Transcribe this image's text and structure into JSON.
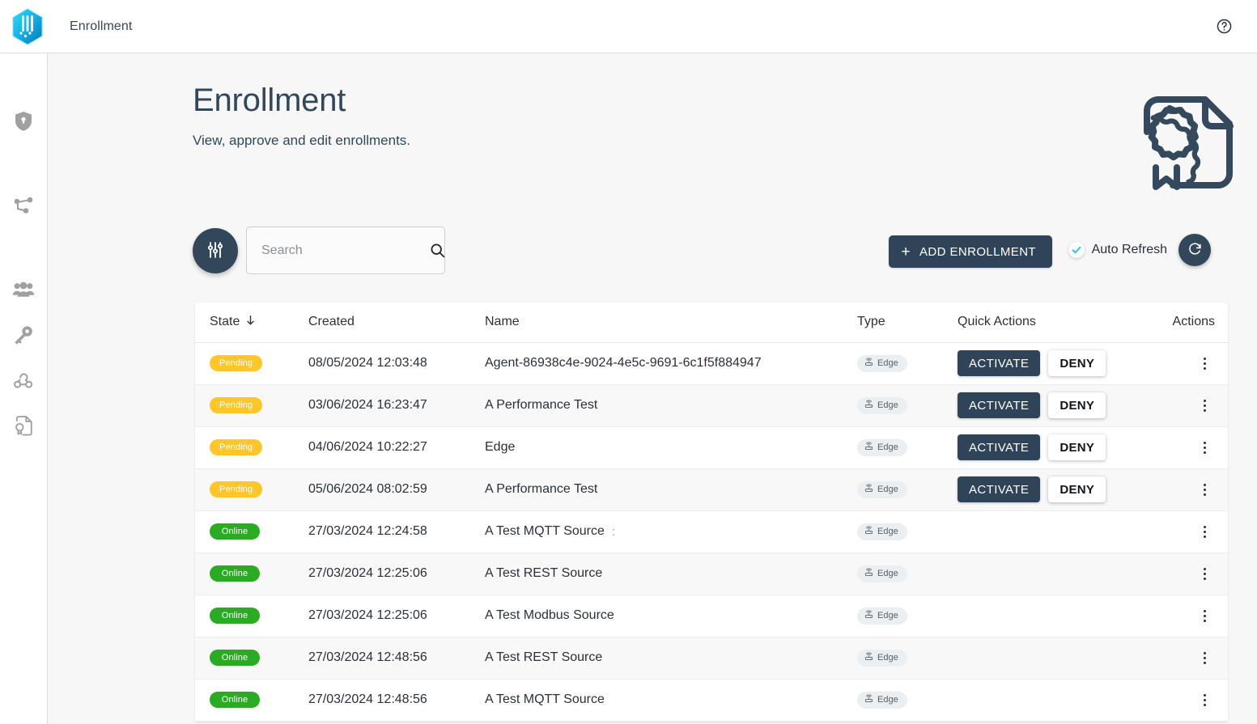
{
  "topbar": {
    "logo_icon": "hexagon-brand-logo",
    "title": "Enrollment",
    "help_icon": "help-circle-icon"
  },
  "sidebar": {
    "items": [
      {
        "icon": "shield-lock-icon",
        "name": "security"
      },
      {
        "icon": "share-network-icon",
        "name": "connections"
      },
      {
        "icon": "people-group-icon",
        "name": "users"
      },
      {
        "icon": "key-icon",
        "name": "credentials"
      },
      {
        "icon": "webhook-icon",
        "name": "webhooks"
      },
      {
        "icon": "certificate-document-icon",
        "name": "enrollment"
      }
    ]
  },
  "page": {
    "title": "Enrollment",
    "subtitle": "View, approve and edit enrollments.",
    "hero_icon": "certificate-document-icon"
  },
  "controls": {
    "filter_icon": "tune-sliders-icon",
    "search": {
      "value": "",
      "placeholder": "Search",
      "icon": "search-icon"
    },
    "add_button": {
      "label": "ADD ENROLLMENT",
      "icon": "plus-icon"
    },
    "auto_refresh": {
      "label": "Auto Refresh",
      "checked": true,
      "icon": "check-icon"
    },
    "refresh_button": {
      "icon": "refresh-icon"
    }
  },
  "table": {
    "columns": [
      {
        "key": "state",
        "label": "State",
        "sort": "desc",
        "sort_icon": "arrow-down-icon"
      },
      {
        "key": "created",
        "label": "Created"
      },
      {
        "key": "name",
        "label": "Name"
      },
      {
        "key": "type",
        "label": "Type"
      },
      {
        "key": "quick",
        "label": "Quick Actions"
      },
      {
        "key": "actions",
        "label": "Actions"
      }
    ],
    "quick_action_labels": {
      "activate": "ACTIVATE",
      "deny": "DENY"
    },
    "rows": [
      {
        "state": "Pending",
        "state_kind": "pending",
        "created": "08/05/2024 12:03:48",
        "name": "Agent-86938c4e-9024-4e5c-9691-6c1f5f884947",
        "name_suffix": "",
        "type": "Edge",
        "type_icon": "router-edge-icon",
        "quick_actions": true
      },
      {
        "state": "Pending",
        "state_kind": "pending",
        "created": "03/06/2024 16:23:47",
        "name": "A Performance Test",
        "name_suffix": "",
        "type": "Edge",
        "type_icon": "router-edge-icon",
        "quick_actions": true
      },
      {
        "state": "Pending",
        "state_kind": "pending",
        "created": "04/06/2024 10:22:27",
        "name": "Edge",
        "name_suffix": "",
        "type": "Edge",
        "type_icon": "router-edge-icon",
        "quick_actions": true
      },
      {
        "state": "Pending",
        "state_kind": "pending",
        "created": "05/06/2024 08:02:59",
        "name": "A Performance Test",
        "name_suffix": "",
        "type": "Edge",
        "type_icon": "router-edge-icon",
        "quick_actions": true
      },
      {
        "state": "Online",
        "state_kind": "online",
        "created": "27/03/2024 12:24:58",
        "name": " A Test MQTT Source",
        "name_suffix": ":",
        "type": "Edge",
        "type_icon": "router-edge-icon",
        "quick_actions": false
      },
      {
        "state": "Online",
        "state_kind": "online",
        "created": "27/03/2024 12:25:06",
        "name": " A Test REST Source",
        "name_suffix": "",
        "type": "Edge",
        "type_icon": "router-edge-icon",
        "quick_actions": false
      },
      {
        "state": "Online",
        "state_kind": "online",
        "created": "27/03/2024 12:25:06",
        "name": "A Test Modbus Source",
        "name_suffix": "",
        "type": "Edge",
        "type_icon": "router-edge-icon",
        "quick_actions": false
      },
      {
        "state": "Online",
        "state_kind": "online",
        "created": "27/03/2024 12:48:56",
        "name": "A Test REST Source",
        "name_suffix": "",
        "type": "Edge",
        "type_icon": "router-edge-icon",
        "quick_actions": false
      },
      {
        "state": "Online",
        "state_kind": "online",
        "created": "27/03/2024 12:48:56",
        "name": "A Test MQTT Source",
        "name_suffix": "",
        "type": "Edge",
        "type_icon": "router-edge-icon",
        "quick_actions": false
      }
    ]
  },
  "colors": {
    "brand_cyan": "#19c8ef",
    "dark_navy": "#2f4459",
    "slate": "#33475b",
    "pending_yellow": "#ffc629",
    "online_green": "#2bab23",
    "page_bg": "#f7f7f7",
    "chip_bg": "#eceff1"
  }
}
